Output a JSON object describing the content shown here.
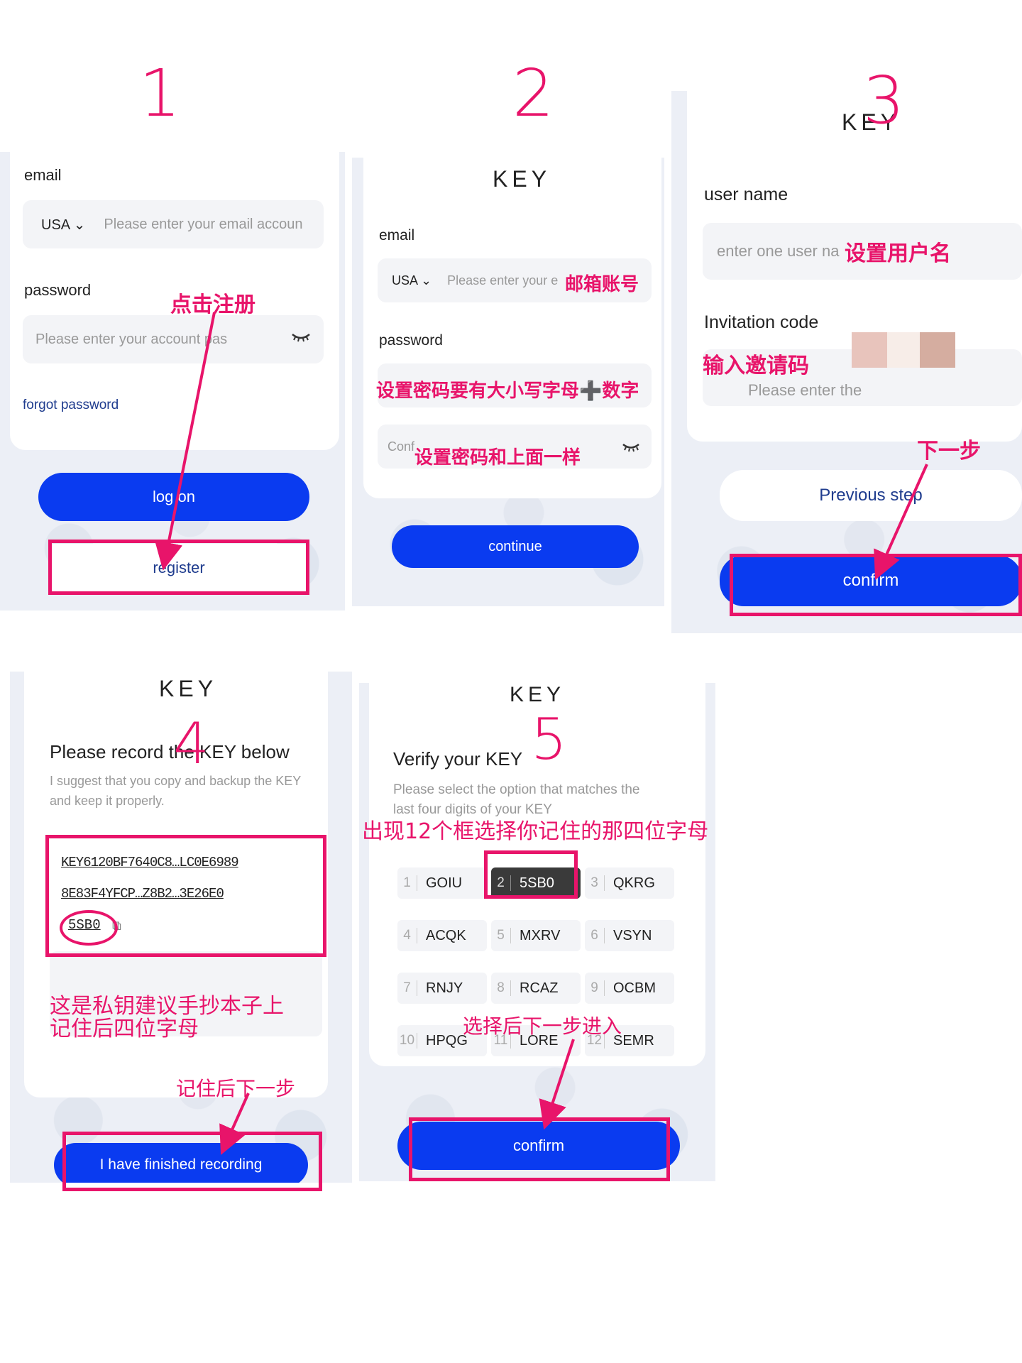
{
  "steps": [
    "1",
    "2",
    "3",
    "4",
    "5"
  ],
  "panel1": {
    "email_label": "email",
    "country": "USA",
    "email_placeholder": "Please enter your email accoun",
    "password_label": "password",
    "password_placeholder": "Please enter your account pas",
    "forgot": "forgot password",
    "login": "log on",
    "register": "register",
    "note_register": "点击注册"
  },
  "panel2": {
    "logo": "KEY",
    "email_label": "email",
    "country": "USA",
    "email_placeholder": "Please enter your e",
    "note_email": "邮箱账号",
    "password_label": "password",
    "note_password": "设置密码要有大小写字母➕数字",
    "confirm_placeholder": "Conf",
    "note_confirm": "设置密码和上面一样",
    "continue": "continue"
  },
  "panel3": {
    "logo": "KEY",
    "username_label": "user name",
    "username_placeholder": "enter one user na",
    "note_username": "设置用户名",
    "invitation_label": "Invitation code",
    "invitation_placeholder": "Please enter the",
    "note_invitation": "输入邀请码",
    "note_next": "下一步",
    "previous": "Previous step",
    "confirm": "confirm"
  },
  "panel4": {
    "logo": "KEY",
    "title": "Please record the KEY below",
    "subtitle_1": "I suggest that you copy and backup the KEY",
    "subtitle_2": "and keep it properly.",
    "key_line1": "KEY6120BF7640C8…LC0E6989",
    "key_line2": "8E83F4YFCP…Z8B2…3E26E0",
    "key_line3": "5SB0",
    "note_private_1": "这是私钥建议手抄本子上",
    "note_private_2": "记住后四位字母",
    "note_next": "记住后下一步",
    "finished": "I have finished recording"
  },
  "panel5": {
    "logo": "KEY",
    "title": "Verify your KEY",
    "subtitle_1": "Please select the option that matches the",
    "subtitle_2": "last four digits of your KEY",
    "note_boxes": "出现12个框选择你记住的那四位字母",
    "options": [
      {
        "n": "1",
        "code": "GOIU"
      },
      {
        "n": "2",
        "code": "5SB0"
      },
      {
        "n": "3",
        "code": "QKRG"
      },
      {
        "n": "4",
        "code": "ACQK"
      },
      {
        "n": "5",
        "code": "MXRV"
      },
      {
        "n": "6",
        "code": "VSYN"
      },
      {
        "n": "7",
        "code": "RNJY"
      },
      {
        "n": "8",
        "code": "RCAZ"
      },
      {
        "n": "9",
        "code": "OCBM"
      },
      {
        "n": "10",
        "code": "HPQG"
      },
      {
        "n": "11",
        "code": "LORE"
      },
      {
        "n": "12",
        "code": "SEMR"
      }
    ],
    "selected_index": 1,
    "note_next": "选择后下一步进入",
    "confirm": "confirm"
  },
  "colors": {
    "accent_red": "#e8146a",
    "button_blue": "#0a3bf0",
    "link_blue": "#1f3c8e"
  }
}
